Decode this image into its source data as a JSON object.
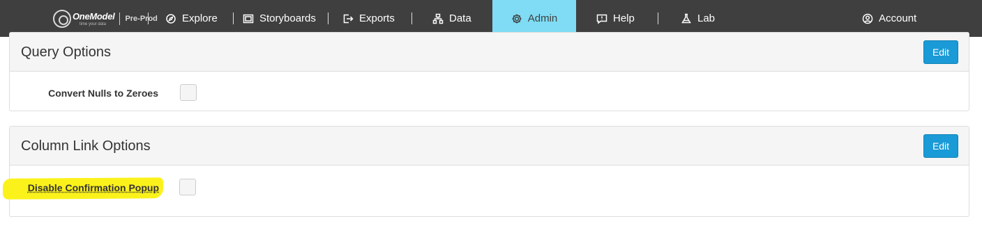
{
  "header": {
    "logo": {
      "name": "OneModel",
      "tagline": "time your data",
      "environment": "Pre-Prod"
    },
    "nav": [
      {
        "label": "Explore",
        "icon": "compass-icon"
      },
      {
        "label": "Storyboards",
        "icon": "storyboard-icon"
      },
      {
        "label": "Exports",
        "icon": "export-icon"
      },
      {
        "label": "Data",
        "icon": "data-tree-icon"
      },
      {
        "label": "Admin",
        "icon": "gear-icon",
        "active": true
      },
      {
        "label": "Help",
        "icon": "help-bubble-icon"
      },
      {
        "label": "Lab",
        "icon": "flask-icon"
      },
      {
        "label": "Account",
        "icon": "user-icon"
      }
    ],
    "colors": {
      "bar": "#3f3f3f",
      "active": "#7fdcf4"
    }
  },
  "panels": [
    {
      "title": "Query Options",
      "edit_label": "Edit",
      "options": [
        {
          "label": "Convert Nulls to Zeroes",
          "checked": false
        }
      ]
    },
    {
      "title": "Column Link Options",
      "edit_label": "Edit",
      "options": [
        {
          "label": "Disable Confirmation Popup",
          "checked": false,
          "highlighted": true
        }
      ]
    }
  ],
  "colors": {
    "edit_button": "#1a9ad6",
    "highlight": "#fbf21b"
  }
}
